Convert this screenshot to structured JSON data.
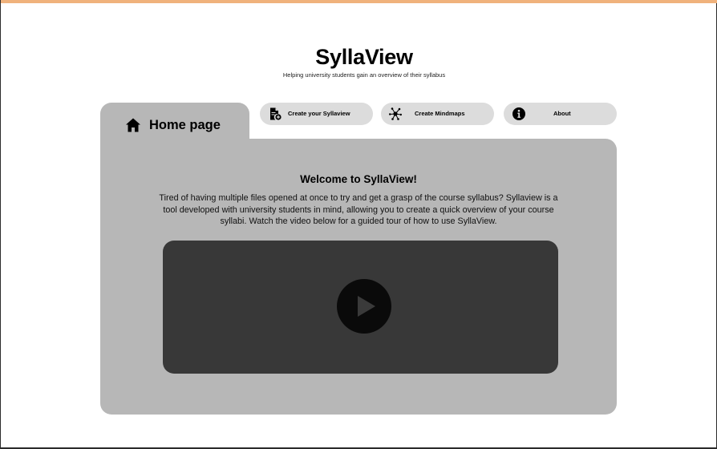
{
  "header": {
    "title": "SyllaView",
    "subtitle": "Helping university students gain an overview of their syllabus"
  },
  "tabs": {
    "home": {
      "label": "Home page",
      "icon": "home-icon"
    },
    "create": {
      "label": "Create your Syllaview",
      "icon": "document-add-icon"
    },
    "mindmaps": {
      "label": "Create Mindmaps",
      "icon": "mindmap-icon"
    },
    "about": {
      "label": "About",
      "icon": "info-icon"
    }
  },
  "main": {
    "welcome_title": "Welcome to SyllaView!",
    "welcome_text": "Tired of having multiple files opened at once to try and get a grasp of the course syllabus? Syllaview is a tool developed with university students in mind, allowing you to create a quick overview of your course syllabi. Watch the video below for a guided tour of how to use SyllaView.",
    "video": {
      "icon": "play-icon"
    }
  },
  "colors": {
    "accent_bar": "#f0b27c",
    "panel": "#b7b7b7",
    "pill": "#dcdcdc",
    "video_bg": "#383838"
  }
}
